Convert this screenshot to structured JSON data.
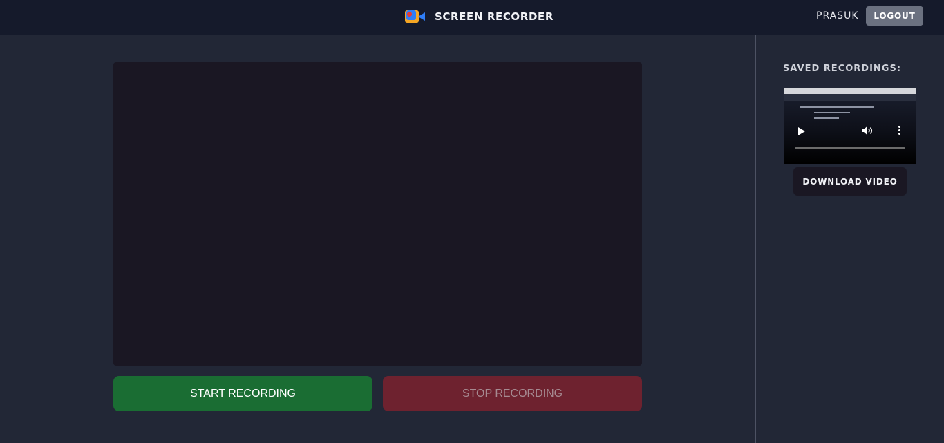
{
  "header": {
    "title": "SCREEN RECORDER",
    "logo_icon": "video-camera-icon",
    "username": "PRASUK",
    "logout_label": "LOGOUT"
  },
  "main": {
    "start_label": "START RECORDING",
    "stop_label": "STOP RECORDING"
  },
  "sidebar": {
    "title": "SAVED RECORDINGS:",
    "recordings": [
      {
        "download_label": "DOWNLOAD VIDEO"
      }
    ]
  },
  "colors": {
    "background": "#222736",
    "header": "#151a2b",
    "start": "#1a6d33",
    "stop": "#6e222f",
    "logout": "#6b7180"
  }
}
